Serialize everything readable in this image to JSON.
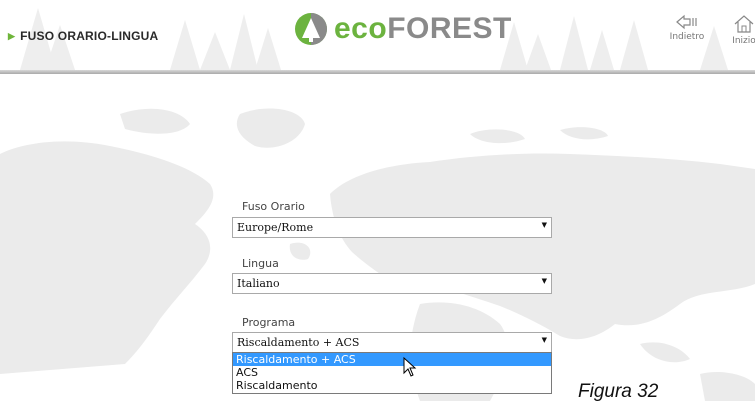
{
  "header": {
    "page_title": "FUSO ORARIO-LINGUA",
    "logo_eco": "eco",
    "logo_forest": "FOREST",
    "back_label": "Indietro",
    "home_label": "Inizio"
  },
  "form": {
    "timezone_label": "Fuso Orario",
    "timezone_value": "Europe/Rome",
    "language_label": "Lingua",
    "language_value": "Italiano",
    "program_label": "Programa",
    "program_value": "Riscaldamento + ACS",
    "program_options": [
      "Riscaldamento + ACS",
      "ACS",
      "Riscaldamento"
    ]
  },
  "caption": "Figura 32",
  "colors": {
    "brand_green": "#6cb33f",
    "brand_gray": "#8a8a8a",
    "selection_blue": "#3399ff"
  },
  "icons": [
    "play-triangle-icon",
    "ecoforest-tree-logo-icon",
    "back-arrow-icon",
    "home-icon",
    "mouse-pointer-icon"
  ]
}
